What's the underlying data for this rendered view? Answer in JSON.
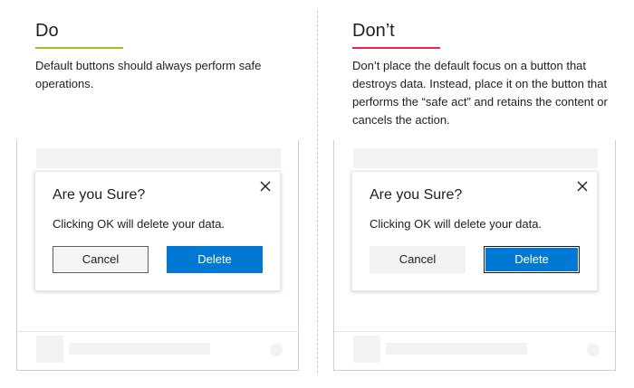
{
  "do": {
    "heading": "Do",
    "accent_color": "#9bc31c",
    "description": "Default buttons should always perform safe operations.",
    "dialog": {
      "title": "Are you Sure?",
      "message": "Clicking OK will delete your data.",
      "cancel_label": "Cancel",
      "delete_label": "Delete",
      "close_icon": "close-icon",
      "focused_button": "Cancel"
    }
  },
  "dont": {
    "heading": "Don’t",
    "accent_color": "#e8274b",
    "description": "Don’t place the default focus on a button that destroys data. Instead, place it on the button that performs the “safe act” and retains the content or cancels the action.",
    "dialog": {
      "title": "Are you Sure?",
      "message": "Clicking OK will delete your data.",
      "cancel_label": "Cancel",
      "delete_label": "Delete",
      "close_icon": "close-icon",
      "focused_button": "Delete"
    }
  },
  "colors": {
    "primary_button": "#0078d4",
    "do_accent": "#9bc31c",
    "dont_accent": "#e8274b"
  }
}
